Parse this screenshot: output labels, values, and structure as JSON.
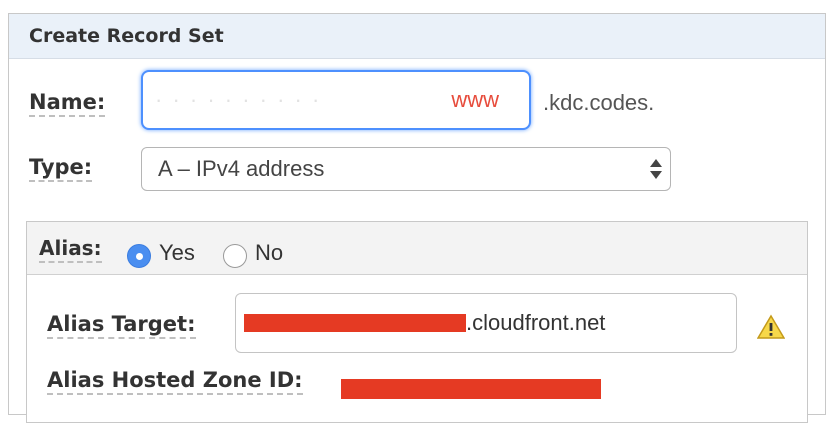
{
  "panel": {
    "title": "Create Record Set"
  },
  "name_field": {
    "label": "Name:",
    "value": "www",
    "suffix": ".kdc.codes."
  },
  "type_field": {
    "label": "Type:",
    "selected": "A – IPv4 address"
  },
  "alias": {
    "label": "Alias:",
    "options": [
      {
        "label": "Yes",
        "checked": true
      },
      {
        "label": "No",
        "checked": false
      }
    ],
    "target_label": "Alias Target:",
    "target_suffix": ".cloudfront.net",
    "hosted_zone_label": "Alias Hosted Zone ID:"
  },
  "icons": {
    "warning": "warning-icon",
    "select_arrows": "updown-arrows-icon"
  },
  "colors": {
    "accent": "#4d90fe",
    "redaction": "#e53a23",
    "header_bg": "#eaf1f9"
  }
}
